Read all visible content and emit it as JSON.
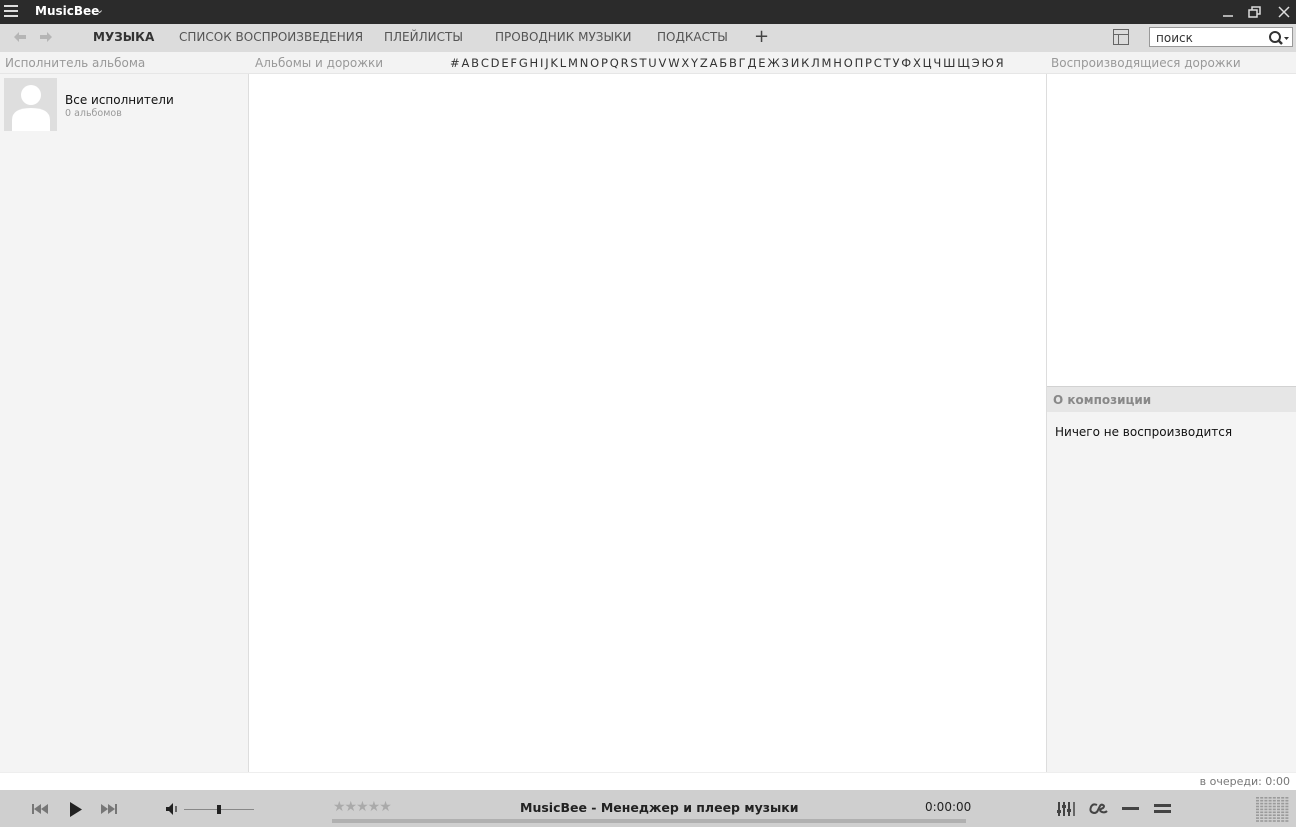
{
  "titlebar": {
    "app_title": "MusicBee"
  },
  "tabs": [
    {
      "label": "МУЗЫКА",
      "active": true
    },
    {
      "label": "СПИСОК ВОСПРОИЗВЕДЕНИЯ",
      "active": false
    },
    {
      "label": "ПЛЕЙЛИСТЫ",
      "active": false
    },
    {
      "label": "ПРОВОДНИК МУЗЫКИ",
      "active": false
    },
    {
      "label": "ПОДКАСТЫ",
      "active": false
    }
  ],
  "search": {
    "placeholder": "поиск"
  },
  "panels": {
    "left_header": "Исполнитель альбома",
    "center_header": "Альбомы и дорожки",
    "right_header": "Воспроизводящиеся дорожки",
    "info_header": "О композиции",
    "info_text": "Ничего не воспроизводится"
  },
  "alphabet": [
    "#",
    "A",
    "B",
    "C",
    "D",
    "E",
    "F",
    "G",
    "H",
    "I",
    "J",
    "K",
    "L",
    "M",
    "N",
    "O",
    "P",
    "Q",
    "R",
    "S",
    "T",
    "U",
    "V",
    "W",
    "X",
    "Y",
    "Z",
    "А",
    "Б",
    "В",
    "Г",
    "Д",
    "Е",
    "Ж",
    "З",
    "И",
    "К",
    "Л",
    "М",
    "Н",
    "О",
    "П",
    "Р",
    "С",
    "Т",
    "У",
    "Ф",
    "Х",
    "Ц",
    "Ч",
    "Ш",
    "Щ",
    "Э",
    "Ю",
    "Я"
  ],
  "artists": [
    {
      "name": "Все исполнители",
      "albums": "0 альбомов"
    }
  ],
  "status": {
    "queue": "в очереди: 0:00"
  },
  "player": {
    "rating_stars": "★★★★★",
    "track": "MusicBee - Менеджер и плеер музыки",
    "time": "0:00:00",
    "volume": 0.5,
    "progress": 0
  },
  "colors": {
    "titlebar_bg": "#2b2b2b",
    "tabbar_bg": "#dcdcdc",
    "player_bg": "#cfcfcf"
  }
}
